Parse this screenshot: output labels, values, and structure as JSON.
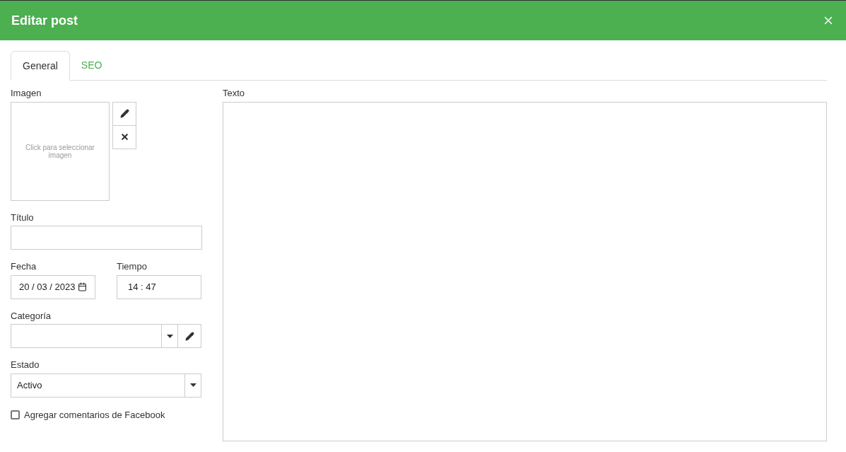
{
  "window": {
    "title": "Editar post"
  },
  "tabs": [
    {
      "label": "General",
      "selected": true
    },
    {
      "label": "SEO",
      "selected": false
    }
  ],
  "image": {
    "label": "Imagen",
    "placeholder": "Click para seleccionar imagen"
  },
  "title_field": {
    "label": "Título"
  },
  "date_field": {
    "label": "Fecha",
    "value": "20 / 03 / 2023"
  },
  "time_field": {
    "label": "Tiempo",
    "value": "14 : 47"
  },
  "category_field": {
    "label": "Categoría"
  },
  "status_field": {
    "label": "Estado",
    "value": "Activo"
  },
  "facebook_comments": {
    "label": "Agregar comentarios de Facebook",
    "checked": false
  },
  "text_field": {
    "label": "Texto"
  }
}
